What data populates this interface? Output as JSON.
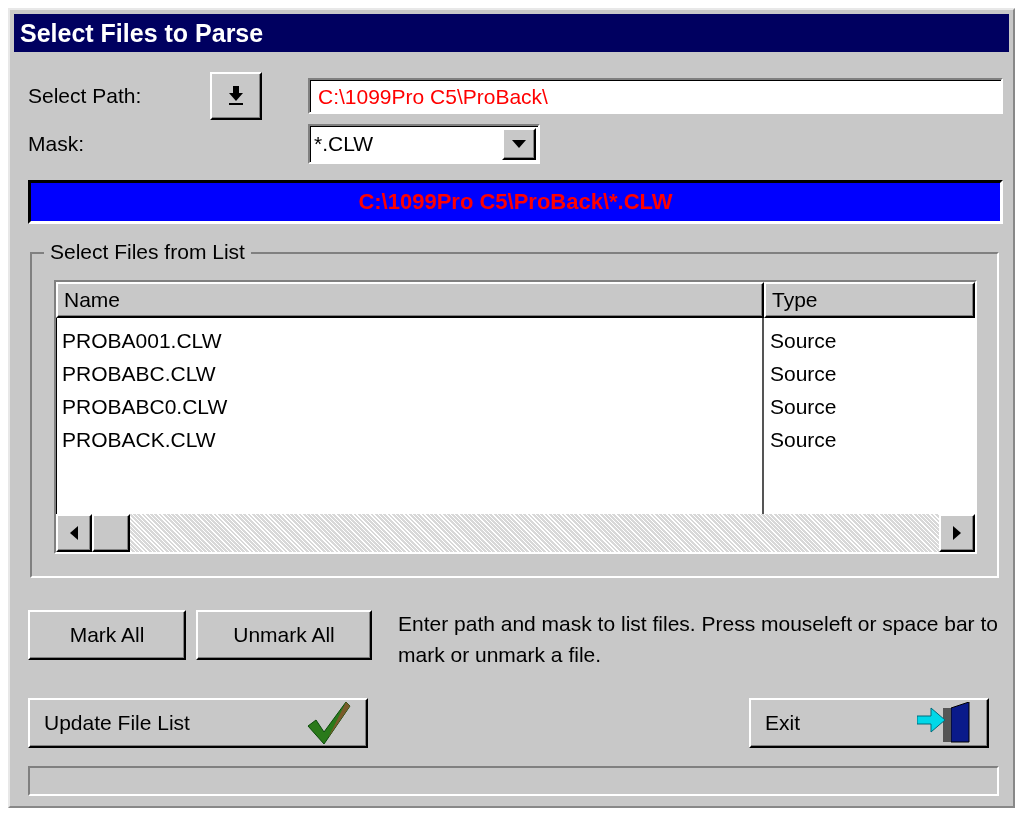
{
  "window": {
    "title": "Select Files to Parse"
  },
  "path": {
    "label": "Select Path:",
    "value": "C:\\1099Pro C5\\ProBack\\"
  },
  "mask": {
    "label": "Mask:",
    "value": "*.CLW"
  },
  "current_path": "C:\\1099Pro C5\\ProBack\\*.CLW",
  "file_group": {
    "title": "Select Files from List",
    "columns": [
      "Name",
      "Type"
    ],
    "rows": [
      [
        "PROBA001.CLW",
        "Source"
      ],
      [
        "PROBABC.CLW",
        "Source"
      ],
      [
        "PROBABC0.CLW",
        "Source"
      ],
      [
        "PROBACK.CLW",
        "Source"
      ]
    ]
  },
  "mark_buttons": [
    {
      "label": "Mark All"
    },
    {
      "label": "Unmark All"
    }
  ],
  "hint": "Enter path and mask to list files.  Press mouseleft or space bar to mark or unmark a file.",
  "update_button": {
    "label": "Update File List"
  },
  "exit_button": {
    "label": "Exit"
  }
}
